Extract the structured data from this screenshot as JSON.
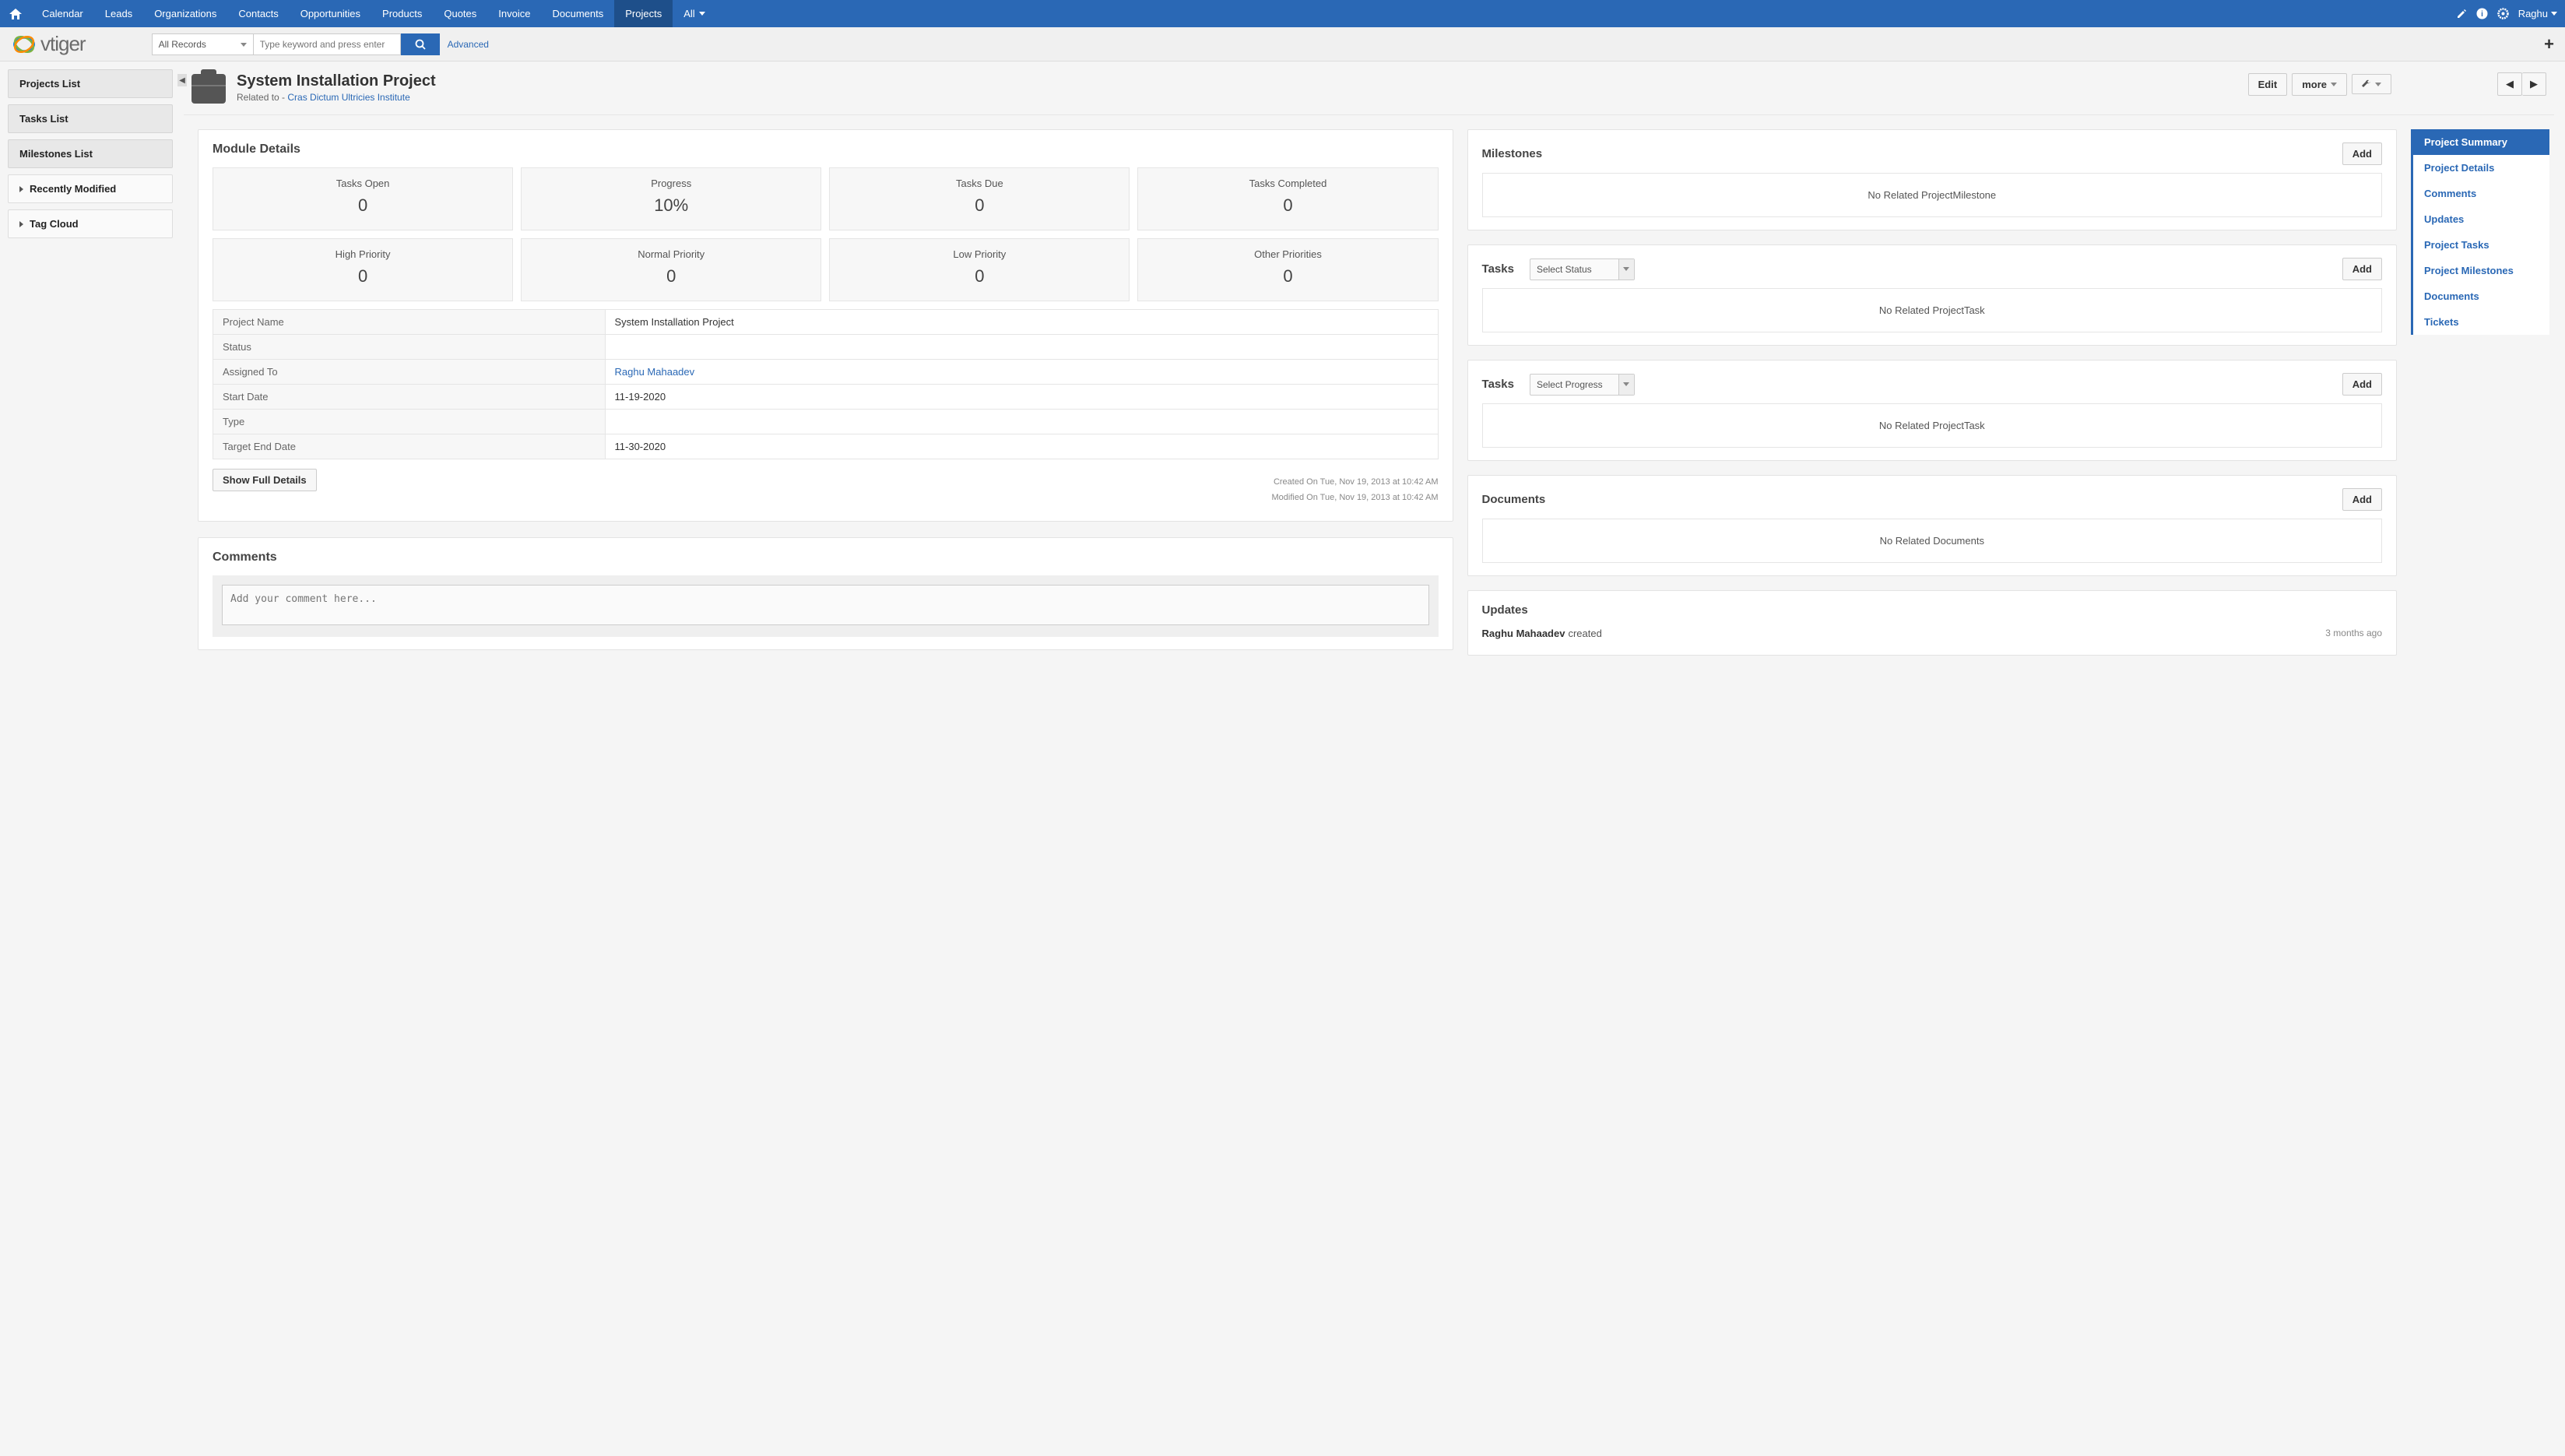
{
  "topnav": {
    "items": [
      "Calendar",
      "Leads",
      "Organizations",
      "Contacts",
      "Opportunities",
      "Products",
      "Quotes",
      "Invoice",
      "Documents",
      "Projects",
      "All"
    ],
    "activeIndex": 9,
    "user": "Raghu"
  },
  "header": {
    "logo_text": "vtiger",
    "records_dd": "All Records",
    "search_placeholder": "Type keyword and press enter",
    "advanced": "Advanced"
  },
  "sidebar": {
    "lists": [
      "Projects List",
      "Tasks List",
      "Milestones List"
    ],
    "collapsibles": [
      "Recently Modified",
      "Tag Cloud"
    ]
  },
  "record": {
    "title": "System Installation Project",
    "related_label": "Related to - ",
    "related_link": "Cras Dictum Ultricies Institute",
    "edit": "Edit",
    "more": "more"
  },
  "module_details": {
    "title": "Module Details",
    "tiles1": [
      {
        "label": "Tasks Open",
        "value": "0"
      },
      {
        "label": "Progress",
        "value": "10%"
      },
      {
        "label": "Tasks Due",
        "value": "0"
      },
      {
        "label": "Tasks Completed",
        "value": "0"
      }
    ],
    "tiles2": [
      {
        "label": "High Priority",
        "value": "0"
      },
      {
        "label": "Normal Priority",
        "value": "0"
      },
      {
        "label": "Low Priority",
        "value": "0"
      },
      {
        "label": "Other Priorities",
        "value": "0"
      }
    ],
    "fields": [
      {
        "label": "Project Name",
        "value": "System Installation Project"
      },
      {
        "label": "Status",
        "value": ""
      },
      {
        "label": "Assigned To",
        "value": "Raghu Mahaadev",
        "link": true
      },
      {
        "label": "Start Date",
        "value": "11-19-2020"
      },
      {
        "label": "Type",
        "value": ""
      },
      {
        "label": "Target End Date",
        "value": "11-30-2020"
      }
    ],
    "show_full": "Show Full Details",
    "created": "Created On Tue, Nov 19, 2013 at 10:42 AM",
    "modified": "Modified On Tue, Nov 19, 2013 at 10:42 AM"
  },
  "comments": {
    "title": "Comments",
    "placeholder": "Add your comment here..."
  },
  "widgets": {
    "milestones": {
      "title": "Milestones",
      "add": "Add",
      "empty": "No Related ProjectMilestone"
    },
    "tasks_status": {
      "title": "Tasks",
      "dd": "Select Status",
      "add": "Add",
      "empty": "No Related ProjectTask"
    },
    "tasks_progress": {
      "title": "Tasks",
      "dd": "Select Progress",
      "add": "Add",
      "empty": "No Related ProjectTask"
    },
    "documents": {
      "title": "Documents",
      "add": "Add",
      "empty": "No Related Documents"
    },
    "updates": {
      "title": "Updates",
      "rows": [
        {
          "who": "Raghu Mahaadev",
          "action": "created",
          "time": "3 months ago"
        }
      ]
    }
  },
  "rightnav": {
    "items": [
      "Project Summary",
      "Project Details",
      "Comments",
      "Updates",
      "Project Tasks",
      "Project Milestones",
      "Documents",
      "Tickets"
    ],
    "activeIndex": 0
  }
}
